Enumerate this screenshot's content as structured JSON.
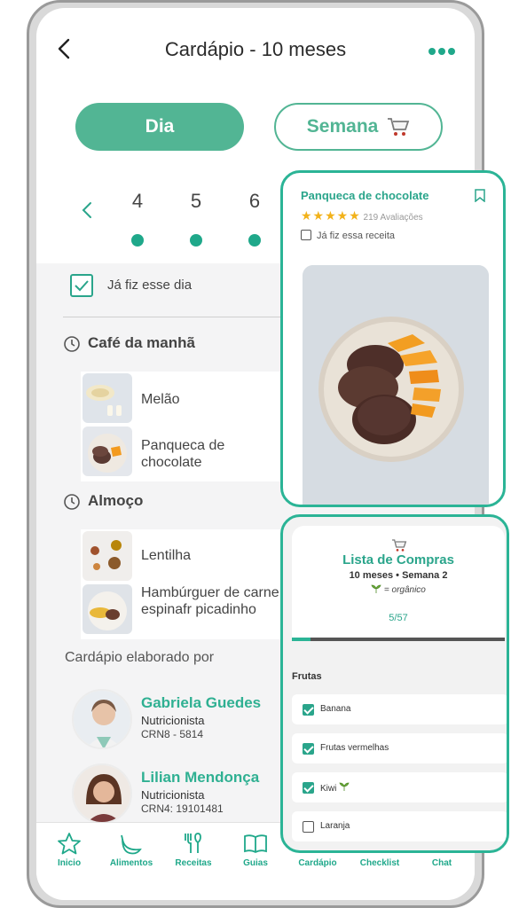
{
  "header": {
    "title": "Cardápio - 10 meses"
  },
  "tabs": {
    "day": "Dia",
    "week": "Semana"
  },
  "days": [
    "4",
    "5",
    "6"
  ],
  "done_day": {
    "label": "Já fiz esse dia",
    "checked": true
  },
  "meals": [
    {
      "title": "Café da manhã",
      "items": [
        "Melão",
        "Panqueca de chocolate"
      ]
    },
    {
      "title": "Almoço",
      "items": [
        "Lentilha",
        "Hambúrguer de carne com espinafr picadinho"
      ]
    }
  ],
  "credits": {
    "label": "Cardápio elaborado por",
    "nutritionists": [
      {
        "name": "Gabriela Guedes",
        "role": "Nutricionista",
        "crn": "CRN8 - 5814"
      },
      {
        "name": "Lilian Mendonça",
        "role": "Nutricionista",
        "crn": "CRN4: 19101481"
      }
    ]
  },
  "bottom_nav": [
    "Inicio",
    "Alimentos",
    "Receitas",
    "Guias",
    "Cardápio",
    "Checklist",
    "Chat"
  ],
  "recipe_card": {
    "title": "Panqueca de chocolate",
    "rating": 5,
    "reviews": "219 Avaliações",
    "made_label": "Já fiz essa receita"
  },
  "shopping_list": {
    "title": "Lista de Compras",
    "subtitle": "10 meses • Semana 2",
    "legend": "= orgânico",
    "progress_text": "5/57",
    "progress_fraction": 0.088,
    "category": "Frutas",
    "items": [
      {
        "name": "Banana",
        "checked": true
      },
      {
        "name": "Frutas vermelhas",
        "checked": true
      },
      {
        "name": "Kiwi",
        "checked": true
      },
      {
        "name": "Laranja",
        "checked": false
      }
    ]
  },
  "colors": {
    "accent": "#1fa88a",
    "accent_soft": "#52b594",
    "star": "#f2b21a"
  }
}
